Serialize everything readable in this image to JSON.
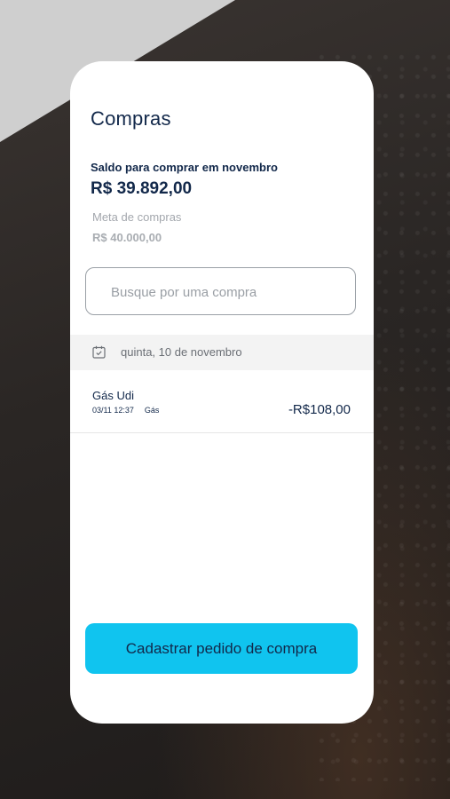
{
  "header": {
    "title": "Compras"
  },
  "balance": {
    "label": "Saldo para comprar em novembro",
    "value": "R$ 39.892,00"
  },
  "goal": {
    "label": "Meta de compras",
    "value": "R$ 40.000,00"
  },
  "search": {
    "placeholder": "Busque por uma compra",
    "value": ""
  },
  "date_group": {
    "icon": "calendar-check-icon",
    "label": "quinta, 10 de novembro"
  },
  "transactions": [
    {
      "name": "Gás Udi",
      "datetime": "03/11 12:37",
      "category": "Gás",
      "amount": "-R$108,00"
    }
  ],
  "actions": {
    "primary_label": "Cadastrar pedido de compra"
  },
  "colors": {
    "accent": "#10c4ef",
    "text_primary": "#12284a",
    "text_muted": "#a3a7ad",
    "date_bar_bg": "#f3f3f3"
  }
}
